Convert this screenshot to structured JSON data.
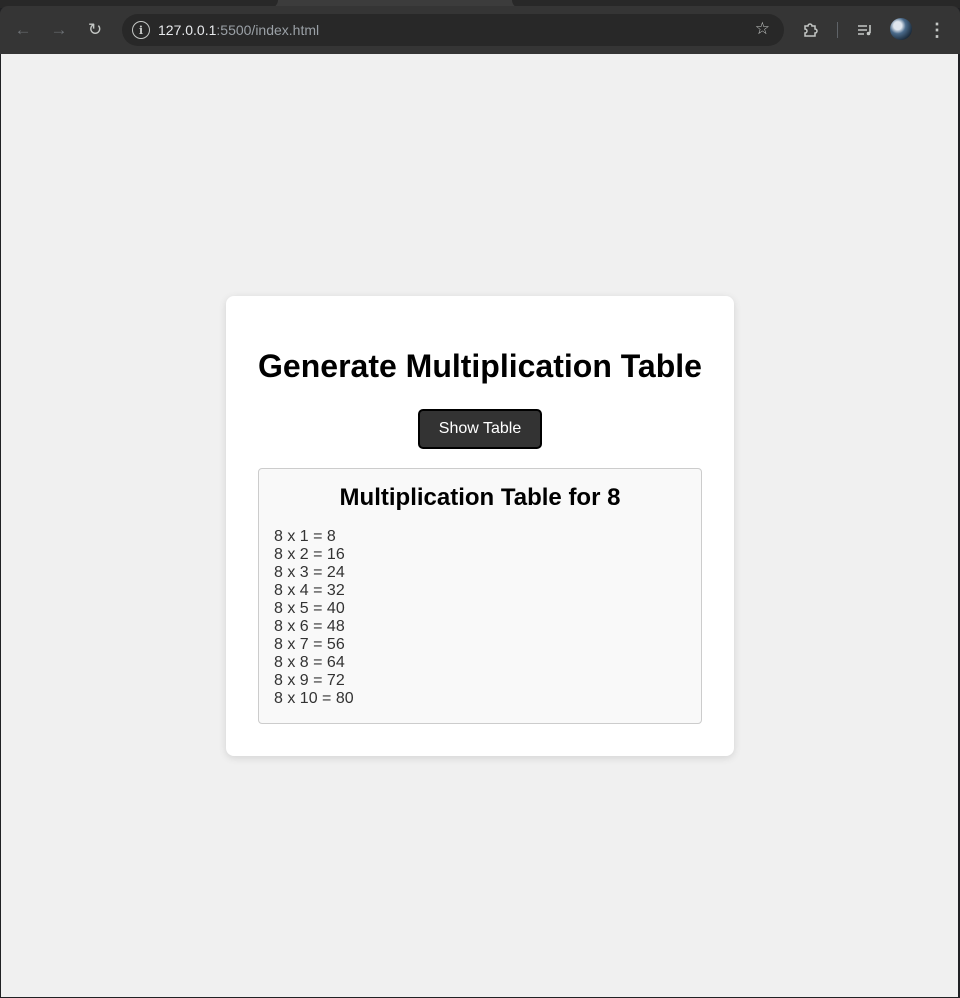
{
  "browser": {
    "url_host": "127.0.0.1",
    "url_rest": ":5500/index.html",
    "icons": {
      "back": "arrow-left",
      "forward": "arrow-right",
      "reload": "refresh",
      "site_info": "info",
      "bookmark": "star",
      "extensions": "puzzle",
      "media": "media-queue",
      "profile": "avatar",
      "menu": "three-dots-vertical"
    }
  },
  "page": {
    "title": "Generate Multiplication Table",
    "button_label": "Show Table",
    "result": {
      "heading": "Multiplication Table for 8",
      "rows": [
        "8 x 1 = 8",
        "8 x 2 = 16",
        "8 x 3 = 24",
        "8 x 4 = 32",
        "8 x 5 = 40",
        "8 x 6 = 48",
        "8 x 7 = 56",
        "8 x 8 = 64",
        "8 x 9 = 72",
        "8 x 10 = 80"
      ]
    }
  },
  "colors": {
    "page_bg": "#f0f0f0",
    "card_bg": "#ffffff",
    "button_bg": "#333333",
    "result_bg": "#f9f9f9"
  }
}
